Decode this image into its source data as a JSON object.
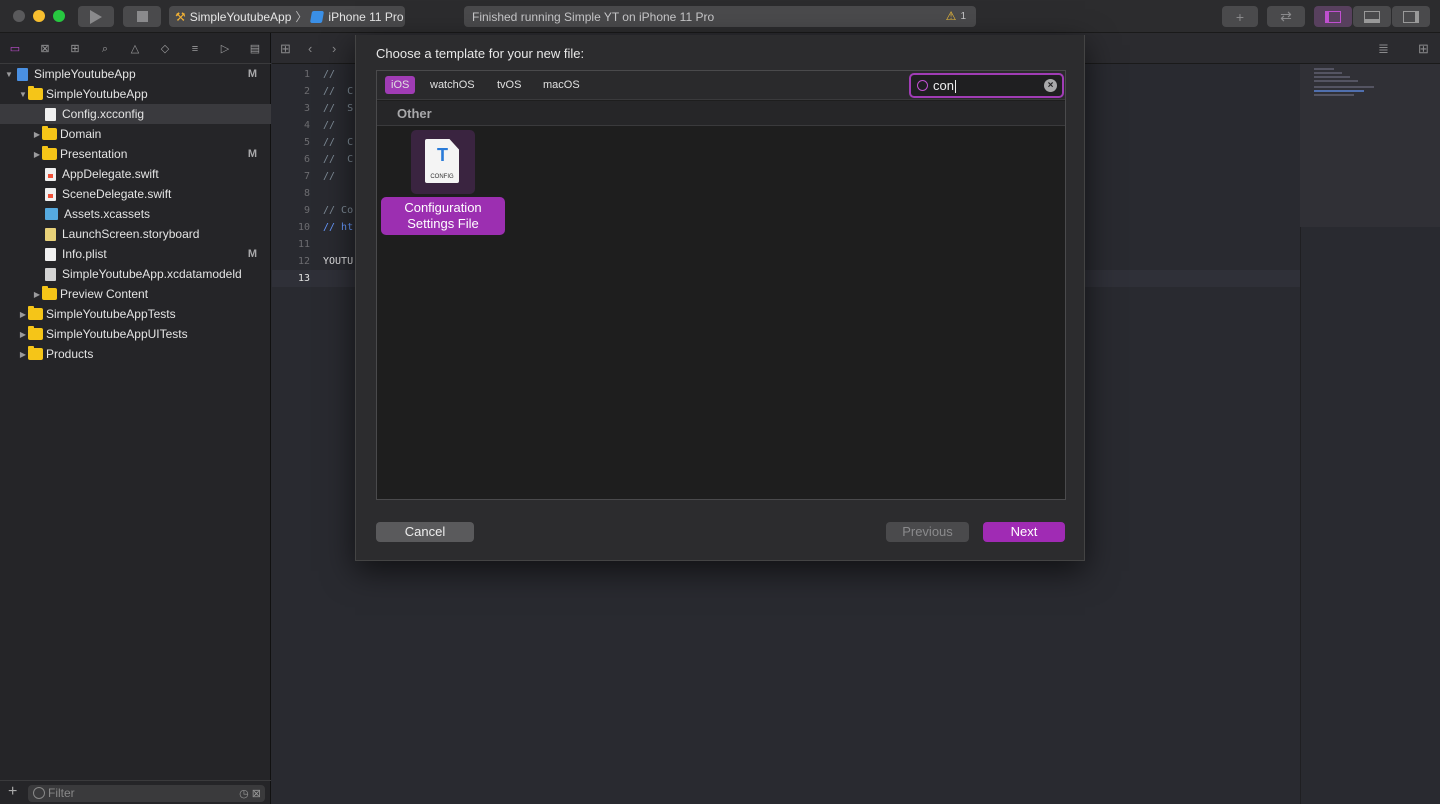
{
  "toolbar": {
    "scheme_project": "SimpleYoutubeApp",
    "scheme_device": "iPhone 11 Pro",
    "status_text": "Finished running Simple YT on iPhone 11 Pro",
    "warning_count": "1"
  },
  "navigator": {
    "tree": [
      {
        "label": "SimpleYoutubeApp",
        "level": 0,
        "type": "project",
        "disc": "▼",
        "badge": "M"
      },
      {
        "label": "SimpleYoutubeApp",
        "level": 1,
        "type": "folder",
        "disc": "▼",
        "badge": ""
      },
      {
        "label": "Config.xcconfig",
        "level": 2,
        "type": "file",
        "disc": "",
        "badge": "",
        "selected": true
      },
      {
        "label": "Domain",
        "level": 2,
        "type": "folder",
        "disc": "▶",
        "badge": ""
      },
      {
        "label": "Presentation",
        "level": 2,
        "type": "folder",
        "disc": "▶",
        "badge": "M"
      },
      {
        "label": "AppDelegate.swift",
        "level": 2,
        "type": "swift",
        "disc": "",
        "badge": ""
      },
      {
        "label": "SceneDelegate.swift",
        "level": 2,
        "type": "swift",
        "disc": "",
        "badge": ""
      },
      {
        "label": "Assets.xcassets",
        "level": 2,
        "type": "assets",
        "disc": "",
        "badge": ""
      },
      {
        "label": "LaunchScreen.storyboard",
        "level": 2,
        "type": "plist",
        "disc": "",
        "badge": ""
      },
      {
        "label": "Info.plist",
        "level": 2,
        "type": "file",
        "disc": "",
        "badge": "M"
      },
      {
        "label": "SimpleYoutubeApp.xcdatamodeld",
        "level": 2,
        "type": "model",
        "disc": "",
        "badge": ""
      },
      {
        "label": "Preview Content",
        "level": 2,
        "type": "folder",
        "disc": "▶",
        "badge": ""
      },
      {
        "label": "SimpleYoutubeAppTests",
        "level": 1,
        "type": "folder",
        "disc": "▶",
        "badge": ""
      },
      {
        "label": "SimpleYoutubeAppUITests",
        "level": 1,
        "type": "folder",
        "disc": "▶",
        "badge": ""
      },
      {
        "label": "Products",
        "level": 1,
        "type": "folder",
        "disc": "▶",
        "badge": ""
      }
    ],
    "filter_placeholder": "Filter"
  },
  "editor": {
    "line_numbers": [
      "1",
      "2",
      "3",
      "4",
      "5",
      "6",
      "7",
      "8",
      "9",
      "10",
      "11",
      "12",
      "13"
    ],
    "current_line": "13",
    "lines": [
      {
        "text": "//",
        "kind": "comment"
      },
      {
        "text": "//  C",
        "kind": "comment"
      },
      {
        "text": "//  S",
        "kind": "comment"
      },
      {
        "text": "//",
        "kind": "comment"
      },
      {
        "text": "//  C",
        "kind": "comment"
      },
      {
        "text": "//  C",
        "kind": "comment"
      },
      {
        "text": "//",
        "kind": "comment"
      },
      {
        "text": "",
        "kind": "comment"
      },
      {
        "text": "// Co",
        "kind": "comment"
      },
      {
        "text": "// ht",
        "kind": "link"
      },
      {
        "text": "",
        "kind": "comment"
      },
      {
        "text": "YOUTU",
        "kind": "plain"
      },
      {
        "text": "",
        "kind": "plain"
      }
    ]
  },
  "sheet": {
    "title": "Choose a template for your new file:",
    "platforms": [
      "iOS",
      "watchOS",
      "tvOS",
      "macOS"
    ],
    "active_platform": "iOS",
    "search_value": "con",
    "section_header": "Other",
    "template_doc_label": "CONFIG",
    "template_name_line1": "Configuration",
    "template_name_line2": "Settings File",
    "cancel_label": "Cancel",
    "previous_label": "Previous",
    "next_label": "Next"
  }
}
